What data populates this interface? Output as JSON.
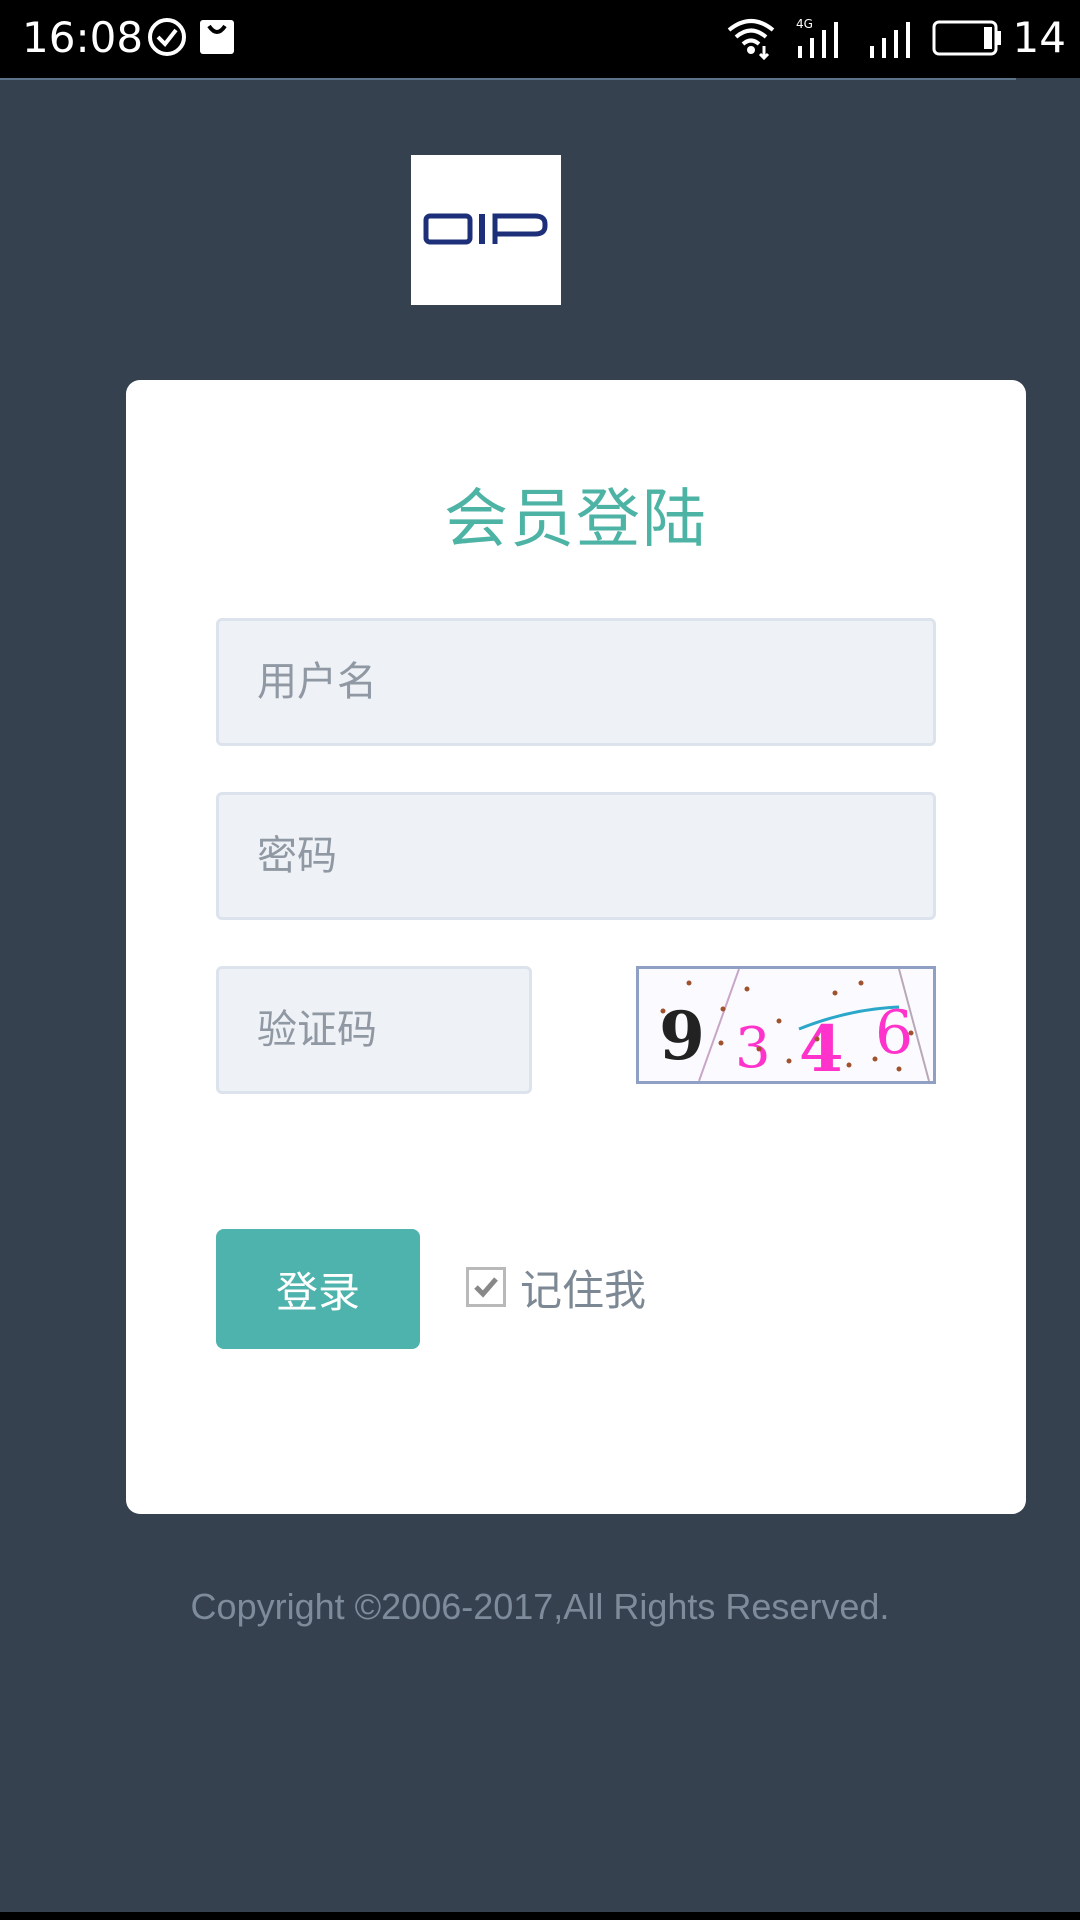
{
  "status_bar": {
    "time": "16:08",
    "battery": "14",
    "icons": [
      "check-circle-icon",
      "shopping-bag-icon",
      "wifi-icon",
      "signal-4g-icon",
      "signal-icon",
      "battery-icon"
    ]
  },
  "logo": {
    "text": "OIP",
    "color": "#1e2f7a"
  },
  "login": {
    "title": "会员登陆",
    "username_placeholder": "用户名",
    "password_placeholder": "密码",
    "captcha_placeholder": "验证码",
    "captcha_text": "9346",
    "submit_label": "登录",
    "remember_label": "记住我",
    "remember_checked": true
  },
  "footer": {
    "copyright": "Copyright ©2006-2017,All Rights Reserved."
  },
  "colors": {
    "background": "#364150",
    "accent": "#4db3ac",
    "card": "#ffffff"
  }
}
